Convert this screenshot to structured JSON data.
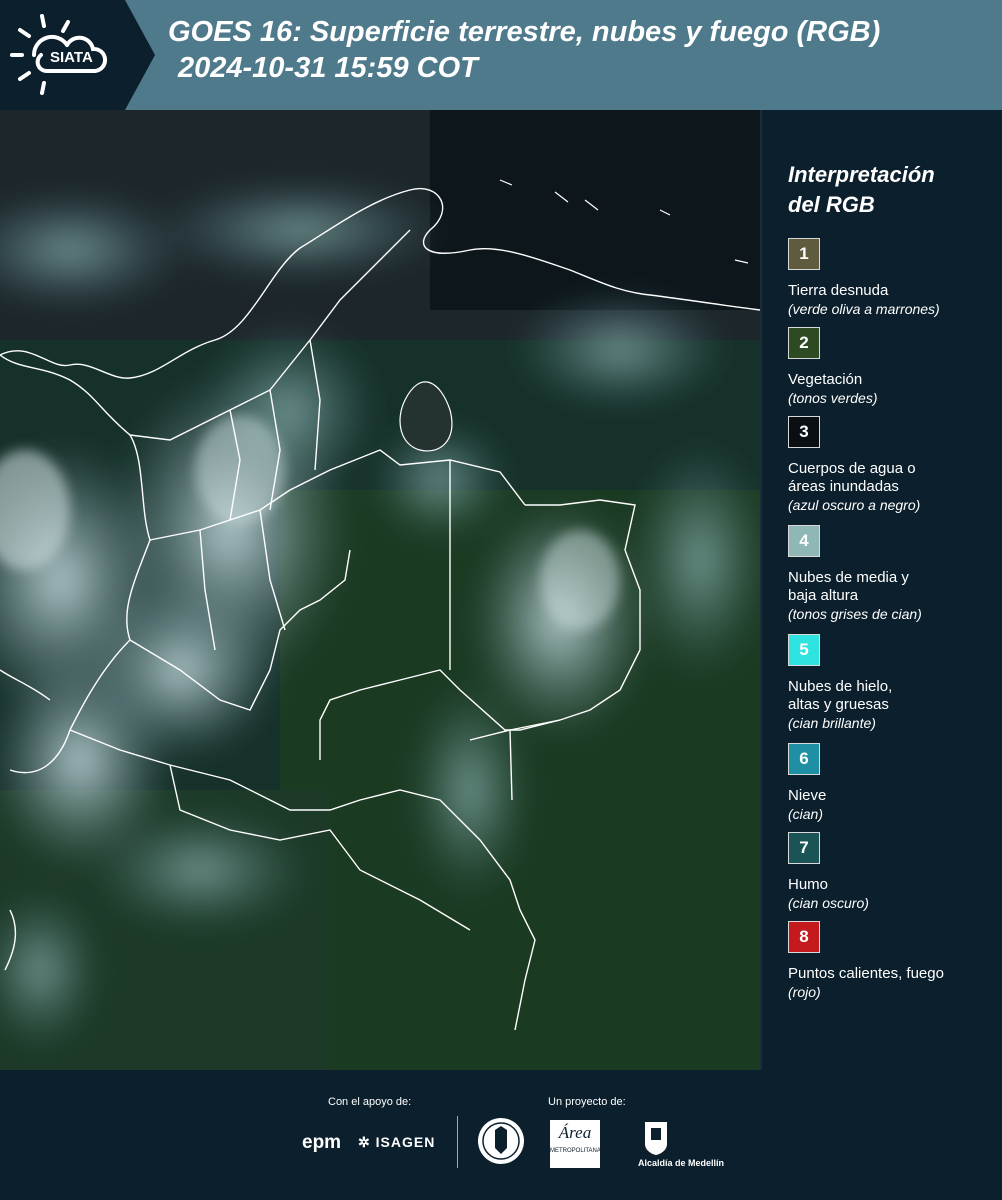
{
  "header": {
    "logo_text": "SIATA",
    "title_line1": "GOES 16: Superficie terrestre, nubes y fuego (RGB)",
    "title_line2": "2024-10-31 15:59 COT"
  },
  "legend": {
    "title": "Interpretación\ndel RGB",
    "items": [
      {
        "number": "1",
        "label": "Tierra desnuda",
        "sub": "(verde oliva a marrones)",
        "color": "#5e5b3f"
      },
      {
        "number": "2",
        "label": "Vegetación",
        "sub": "(tonos verdes)",
        "color": "#2d4a22"
      },
      {
        "number": "3",
        "label": "Cuerpos de agua o\náreas inundadas",
        "sub": "(azul oscuro a negro)",
        "color": "#0a0f14"
      },
      {
        "number": "4",
        "label": "Nubes de media y\nbaja altura",
        "sub": "(tonos grises de cian)",
        "color": "#8fb7b5"
      },
      {
        "number": "5",
        "label": "Nubes de hielo,\naltas y gruesas",
        "sub": "(cian brillante)",
        "color": "#2fe3e0"
      },
      {
        "number": "6",
        "label": "Nieve",
        "sub": "(cian)",
        "color": "#1f8fa4"
      },
      {
        "number": "7",
        "label": "Humo",
        "sub": "(cian oscuro)",
        "color": "#1b5456"
      },
      {
        "number": "8",
        "label": "Puntos calientes, fuego",
        "sub": "(rojo)",
        "color": "#c41a1d"
      }
    ]
  },
  "footer": {
    "support_label": "Con el apoyo de:",
    "project_label": "Un proyecto de:",
    "epm": "epm",
    "isagen": "ISAGEN",
    "area_metro": "Área",
    "area_metro_sub": "METROPOLITANA",
    "alcaldia": "Alcaldía de Medellín"
  }
}
